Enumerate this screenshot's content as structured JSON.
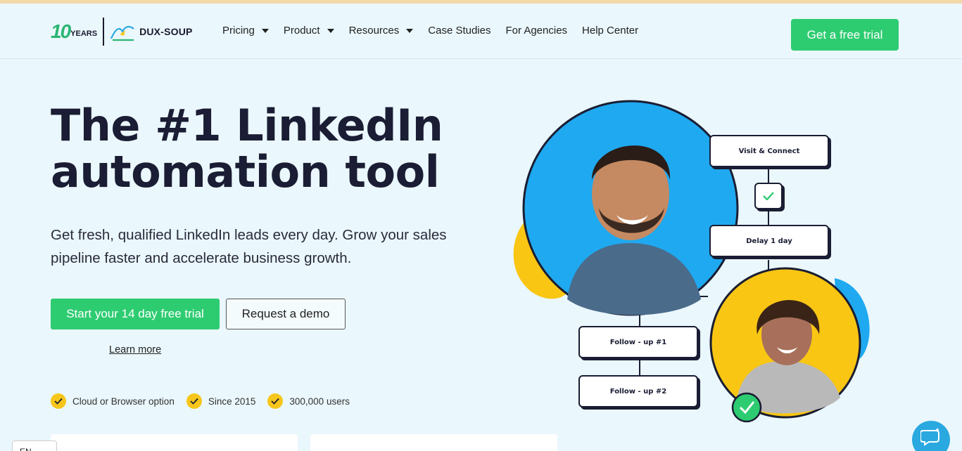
{
  "header": {
    "logo_years_number": "10",
    "logo_years_label": "YEARS",
    "brand": "DUX-SOUP",
    "nav": [
      {
        "label": "Pricing",
        "dropdown": true
      },
      {
        "label": "Product",
        "dropdown": true
      },
      {
        "label": "Resources",
        "dropdown": true
      },
      {
        "label": "Case Studies",
        "dropdown": false
      },
      {
        "label": "For Agencies",
        "dropdown": false
      },
      {
        "label": "Help Center",
        "dropdown": false
      }
    ],
    "cta": "Get a free trial"
  },
  "hero": {
    "headline_line1": "The #1 LinkedIn",
    "headline_line2": "automation tool",
    "subtext_line1": "Get fresh, qualified LinkedIn leads every day. Grow your sales",
    "subtext_line2": "pipeline faster and accelerate business growth.",
    "primary_button": "Start your 14 day free trial",
    "secondary_button": "Request a demo",
    "learn_more": "Learn more",
    "badges": [
      "Cloud or Browser option",
      "Since 2015",
      "300,000 users"
    ]
  },
  "flow": {
    "step1": "Visit & Connect",
    "step2": "Delay 1 day",
    "step3": "Follow - up #1",
    "step4": "Follow - up #2"
  },
  "footer": {
    "language": "EN"
  },
  "colors": {
    "accent_green": "#2ecc71",
    "badge_yellow": "#f7c61b",
    "page_bg": "#eaf7fc",
    "circle_blue": "#1fa9f0",
    "circle_yellow": "#f9c613",
    "navy": "#1a1d33"
  }
}
